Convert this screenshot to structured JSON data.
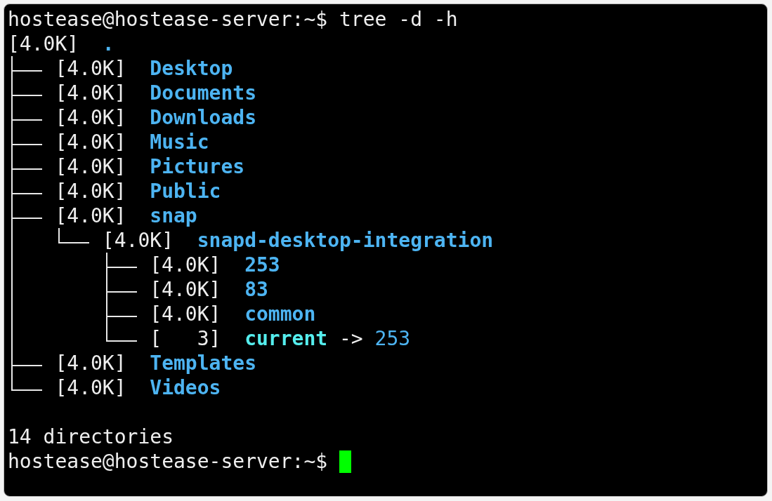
{
  "terminal": {
    "command_line": {
      "prompt": "hostease@hostease-server:~$",
      "command": "tree -d -h"
    },
    "tree": {
      "size": "[4.0K]",
      "name": ".",
      "kind": "dir",
      "children": [
        {
          "size": "[4.0K]",
          "name": "Desktop",
          "kind": "dir"
        },
        {
          "size": "[4.0K]",
          "name": "Documents",
          "kind": "dir"
        },
        {
          "size": "[4.0K]",
          "name": "Downloads",
          "kind": "dir"
        },
        {
          "size": "[4.0K]",
          "name": "Music",
          "kind": "dir"
        },
        {
          "size": "[4.0K]",
          "name": "Pictures",
          "kind": "dir"
        },
        {
          "size": "[4.0K]",
          "name": "Public",
          "kind": "dir"
        },
        {
          "size": "[4.0K]",
          "name": "snap",
          "kind": "dir",
          "children": [
            {
              "size": "[4.0K]",
              "name": "snapd-desktop-integration",
              "kind": "dir",
              "children": [
                {
                  "size": "[4.0K]",
                  "name": "253",
                  "kind": "dir"
                },
                {
                  "size": "[4.0K]",
                  "name": "83",
                  "kind": "dir"
                },
                {
                  "size": "[4.0K]",
                  "name": "common",
                  "kind": "dir"
                },
                {
                  "size": "[   3]",
                  "name": "current",
                  "kind": "link",
                  "arrow": "->",
                  "target": "253"
                }
              ]
            }
          ]
        },
        {
          "size": "[4.0K]",
          "name": "Templates",
          "kind": "dir"
        },
        {
          "size": "[4.0K]",
          "name": "Videos",
          "kind": "dir"
        }
      ]
    },
    "summary": "14 directories",
    "final_prompt": {
      "prompt": "hostease@hostease-server:~$",
      "cursor": true
    }
  }
}
